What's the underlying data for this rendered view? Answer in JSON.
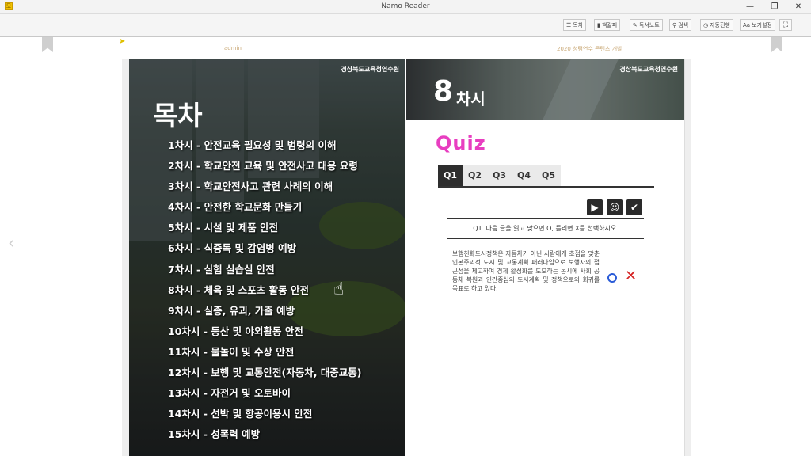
{
  "window": {
    "title": "Namo Reader",
    "app_icon_glyph": "모",
    "controls": {
      "minimize": "—",
      "restore": "❐",
      "close": "✕"
    }
  },
  "toolbar": {
    "toc": "목차",
    "bookmark": "책갈피",
    "note": "독서노트",
    "search": "검색",
    "auto": "자동진행",
    "view": "보기설정",
    "icons": {
      "toc": "list-icon",
      "bookmark": "bookmark-icon",
      "note": "pencil-icon",
      "search": "search-icon",
      "auto": "timer-icon",
      "view": "text-size-icon",
      "fullscreen": "fullscreen-icon"
    }
  },
  "header": {
    "left_text": "admin",
    "right_text": "2020 청렴연수 콘텐츠 개발"
  },
  "left_page": {
    "org": "경상북도교육청연수원",
    "title": "목차",
    "items": [
      "1차시 - 안전교육 필요성 및 범령의 이해",
      "2차시 - 학교안전 교육 및 안전사고 대응 요령",
      "3차시 - 학교안전사고 관련 사례의 이해",
      "4차시 - 안전한 학교문화 만들기",
      "5차시 - 시설 및 제품 안전",
      "6차시 - 식중독 및 감염병 예방",
      "7차시 - 실험 실습실 안전",
      "8차시 - 체육 및 스포츠 활동 안전",
      "9차시 - 실종, 유괴, 가출 예방",
      "10차시 - 등산 및 야외활동 안전",
      "11차시 - 물놀이 및 수상 안전",
      "12차시 - 보행 및 교통안전(자동차, 대중교통)",
      "13차시 - 자전거 및 오토바이",
      "14차시 - 선박 및 항공이용시 안전",
      "15차시 - 성폭력 예방"
    ]
  },
  "right_page": {
    "org": "경상북도교육청연수원",
    "chasi_num": "8",
    "chasi_label": "차시",
    "quiz_title": "Quiz",
    "tabs": [
      "Q1",
      "Q2",
      "Q3",
      "Q4",
      "Q5"
    ],
    "active_tab": "Q1",
    "question": "Q1. 다음 글을 읽고 맞으면 O, 틀리면 X를 선택하시오.",
    "passage": "보행친화도시정책은 자동차가 아닌 사람에게 초점을 맞춘 인본주의적 도시 및 교통계획 패러다임으로 보행자의 접근성을 제고하여 경제 활성화를 도모하는 동시에 사회 공동체 복원과 인간중심의 도시계획 및 정책으로의 회귀를 목표로 하고 있다.",
    "option_o": "O",
    "option_x": "✕",
    "controls": {
      "play": "▶",
      "hint": "☺",
      "check": "✔"
    }
  },
  "nav": {
    "prev": "‹"
  }
}
